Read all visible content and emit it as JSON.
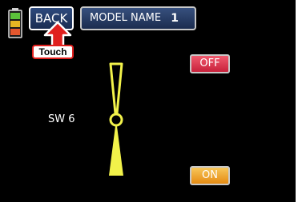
{
  "header": {
    "back_label": "BACK",
    "model_label": "MODEL NAME",
    "model_number": "1"
  },
  "hint": {
    "touch_label": "Touch"
  },
  "switch": {
    "name": "SW 6",
    "off_label": "OFF",
    "on_label": "ON",
    "position": "ON"
  },
  "battery": {
    "level_bars": 3,
    "colors": [
      "#5bc23a",
      "#e8b623",
      "#e4572e"
    ]
  },
  "colors": {
    "screen_bg": "#000000",
    "button_blue": "#1b2c4f",
    "off_red": "#e0304a",
    "on_orange": "#f0a020",
    "lever_yellow": "#f2f24a",
    "hint_red": "#e0201e"
  },
  "icons": {
    "battery": "battery-icon",
    "touch_arrow": "up-arrow-icon",
    "switch_lever": "toggle-switch-icon"
  }
}
